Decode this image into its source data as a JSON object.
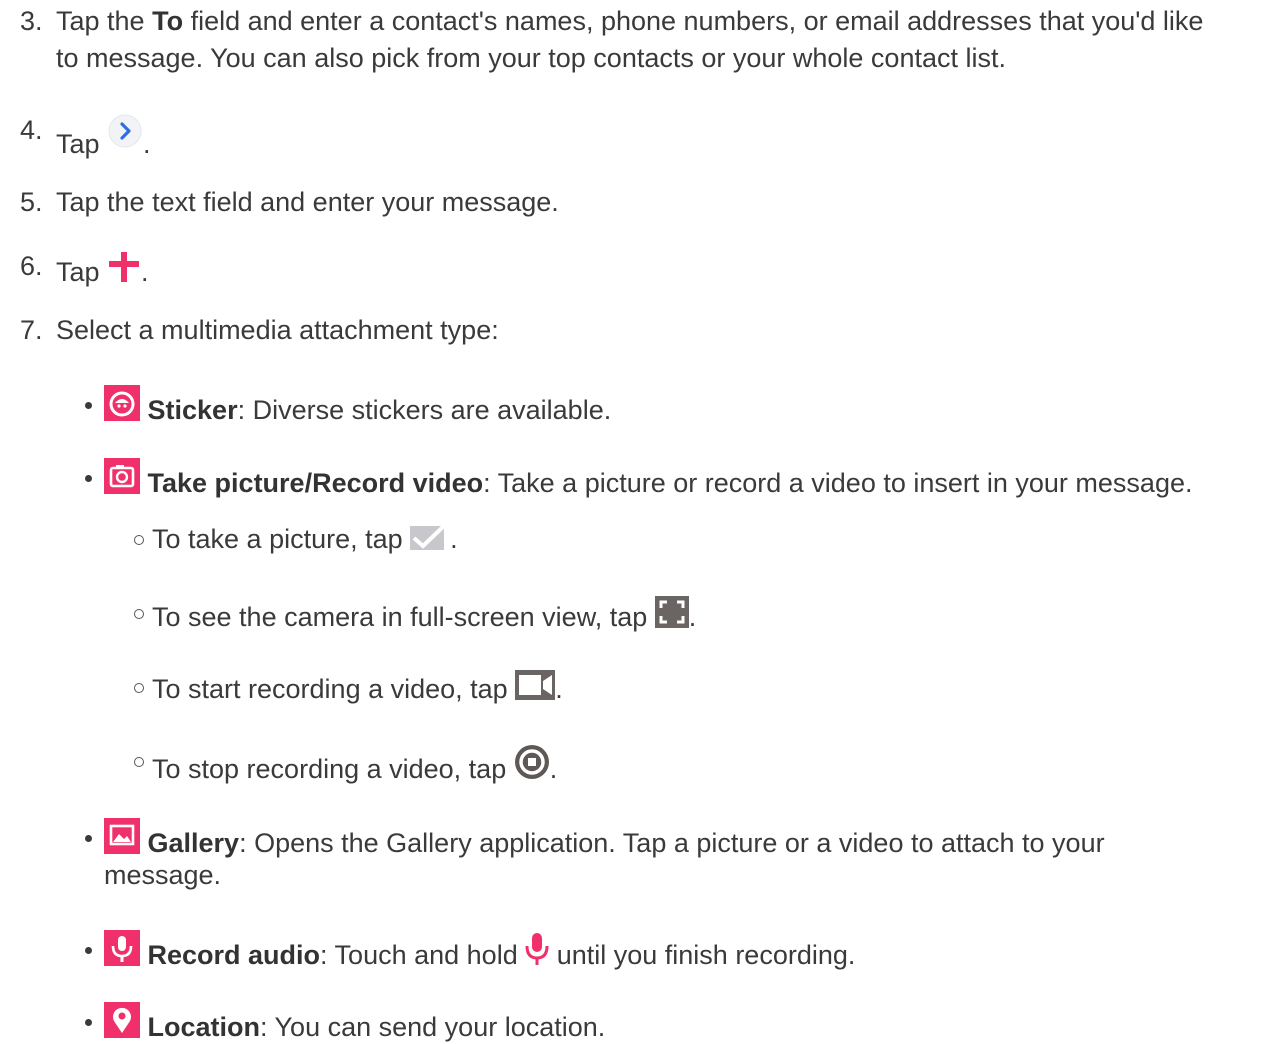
{
  "steps": [
    {
      "number": "3.",
      "line1_pre": "Tap the ",
      "line1_bold": "To",
      "line1_post": " field and enter a contact's names, phone numbers, or email addresses that you'd like",
      "line2": "to message. You can also pick from your top contacts or your whole contact list."
    },
    {
      "number": "4.",
      "pre": "Tap ",
      "post": "."
    },
    {
      "number": "5.",
      "text": "Tap the text field and enter your message."
    },
    {
      "number": "6.",
      "pre": "Tap ",
      "post": "."
    },
    {
      "number": "7.",
      "text": "Select a multimedia attachment type:"
    }
  ],
  "attachments": [
    {
      "icon": "sticker-icon",
      "label": "Sticker",
      "desc": ": Diverse stickers are available."
    },
    {
      "icon": "camera-icon",
      "label": "Take picture/Record video",
      "desc": ": Take a picture or record a video to insert in your message.",
      "sub": [
        {
          "pre": "To take a picture, tap ",
          "icon": "checkmark-icon",
          "post": "."
        },
        {
          "pre": "To see the camera in full-screen view, tap ",
          "icon": "fullscreen-icon",
          "post": "."
        },
        {
          "pre": "To start recording a video, tap ",
          "icon": "video-camera-icon",
          "post": "."
        },
        {
          "pre": "To stop recording a video, tap ",
          "icon": "stop-record-icon",
          "post": "."
        }
      ]
    },
    {
      "icon": "gallery-icon",
      "label": "Gallery",
      "desc": ": Opens the Gallery application. Tap a picture or a video to attach to your",
      "desc2": "message."
    },
    {
      "icon": "microphone-icon",
      "label": "Record audio",
      "desc_pre": ": Touch and hold ",
      "desc_post": " until you finish recording."
    },
    {
      "icon": "location-icon",
      "label": "Location",
      "desc": ": You can send your location."
    }
  ],
  "colors": {
    "accent": "#f0306a",
    "link_blue": "#2f6de0",
    "text": "#3a3a3a"
  }
}
